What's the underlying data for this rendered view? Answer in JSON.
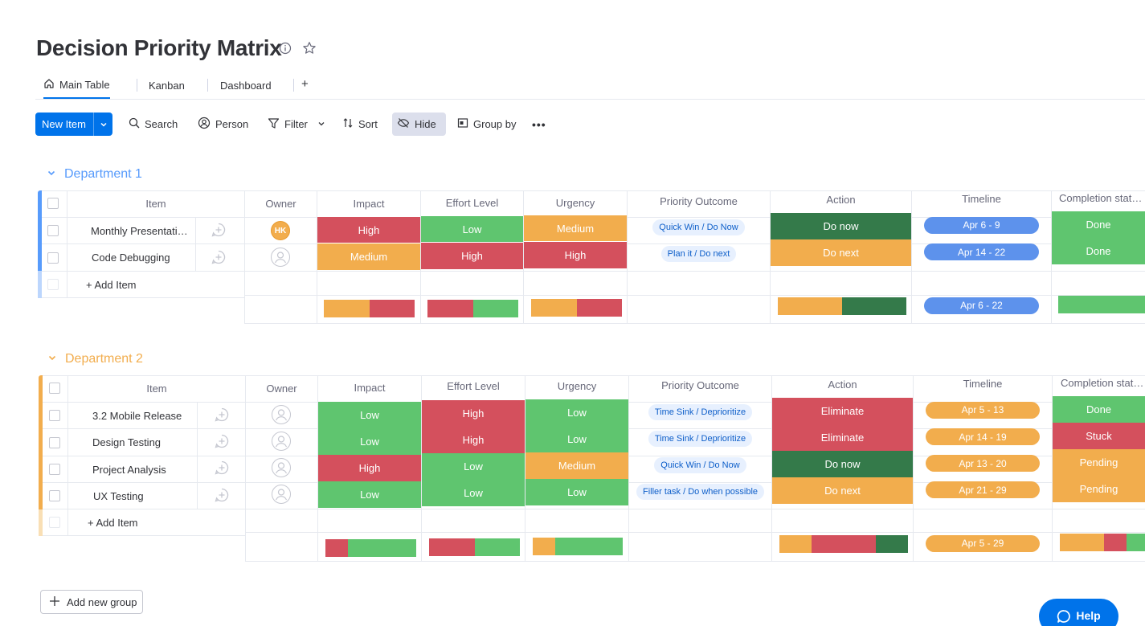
{
  "board": {
    "title": "Decision Priority Matrix"
  },
  "tabs": [
    {
      "label": "Main Table",
      "active": true
    },
    {
      "label": "Kanban"
    },
    {
      "label": "Dashboard"
    },
    {
      "label": "+"
    }
  ],
  "toolbar": {
    "new_item": "New Item",
    "search": "Search",
    "person": "Person",
    "filter": "Filter",
    "sort": "Sort",
    "hide": "Hide",
    "group_by": "Group by",
    "more": "•••"
  },
  "columns": [
    "Item",
    "Owner",
    "Impact",
    "Effort Level",
    "Urgency",
    "Priority Outcome",
    "Action",
    "Timeline",
    "Completion stat…"
  ],
  "colors": {
    "green": "#5fc56f",
    "red": "#d4505d",
    "orange": "#f2ad4d",
    "darkgreen": "#347a4a",
    "blue": "#5d92ec",
    "group1": "#579bfc",
    "group2": "#f2ad4d",
    "pill_bg": "#e7f0fe",
    "pill_text": "#0d5ec9"
  },
  "groups": [
    {
      "name": "Department 1",
      "color": "#579bfc",
      "add_item": "+ Add Item",
      "items": [
        {
          "name": "Monthly Presentati…",
          "owner": "HK",
          "impact": "High",
          "effort": "Low",
          "urgency": "Medium",
          "priority": "Quick Win / Do Now",
          "action": "Do now",
          "timeline": "Apr 6 - 9",
          "completion": "Done"
        },
        {
          "name": "Code Debugging",
          "owner": "",
          "impact": "Medium",
          "effort": "High",
          "urgency": "High",
          "priority": "Plan it / Do next",
          "action": "Do next",
          "timeline": "Apr 14 - 22",
          "completion": "Done"
        }
      ],
      "summary": {
        "timeline": "Apr 6 - 22"
      }
    },
    {
      "name": "Department 2",
      "color": "#f2ad4d",
      "add_item": "+ Add Item",
      "items": [
        {
          "name": "3.2 Mobile Release",
          "owner": "",
          "impact": "Low",
          "effort": "High",
          "urgency": "Low",
          "priority": "Time Sink / Deprioritize",
          "action": "Eliminate",
          "timeline": "Apr 5 - 13",
          "completion": "Done"
        },
        {
          "name": "Design Testing",
          "owner": "",
          "impact": "Low",
          "effort": "High",
          "urgency": "Low",
          "priority": "Time Sink / Deprioritize",
          "action": "Eliminate",
          "timeline": "Apr 14 - 19",
          "completion": "Stuck"
        },
        {
          "name": "Project Analysis",
          "owner": "",
          "impact": "High",
          "effort": "Low",
          "urgency": "Medium",
          "priority": "Quick Win / Do Now",
          "action": "Do now",
          "timeline": "Apr 13 - 20",
          "completion": "Pending"
        },
        {
          "name": "UX Testing",
          "owner": "",
          "impact": "Low",
          "effort": "Low",
          "urgency": "Low",
          "priority": "Filler task / Do when possible",
          "action": "Do next",
          "timeline": "Apr 21 - 29",
          "completion": "Pending"
        }
      ],
      "summary": {
        "timeline": "Apr 5 - 29"
      }
    }
  ],
  "footer": {
    "add_group": "Add new group",
    "help": "Help"
  }
}
